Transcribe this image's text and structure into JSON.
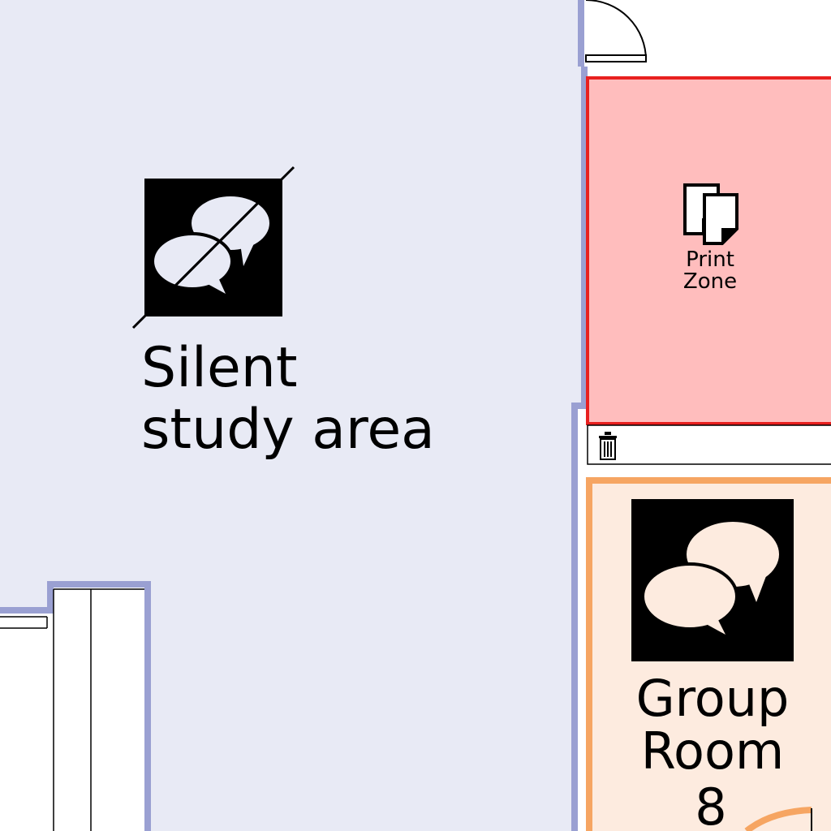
{
  "colors": {
    "silent_area_fill": "#e8eaf5",
    "silent_area_border": "#9aa0d2",
    "print_zone_fill": "#ffbdbd",
    "print_zone_border": "#e8201f",
    "group_room_fill": "#fdebdf",
    "group_room_border": "#f6a562",
    "icon_black": "#000000",
    "bubble_light": "#e8eaf5",
    "bubble_warm": "#fdebdf"
  },
  "silent_area": {
    "label_line1": "Silent",
    "label_line2": "study area",
    "icon": "no-talking-icon"
  },
  "print_zone": {
    "label_line1": "Print",
    "label_line2": "Zone",
    "icon": "printer-pages-icon"
  },
  "group_room": {
    "label_line1": "Group",
    "label_line2": "Room",
    "label_line3": "8",
    "icon": "speech-bubbles-icon"
  },
  "amenities": {
    "trash_icon": "trash-bin-icon",
    "door_icon": "door-swing-icon"
  }
}
